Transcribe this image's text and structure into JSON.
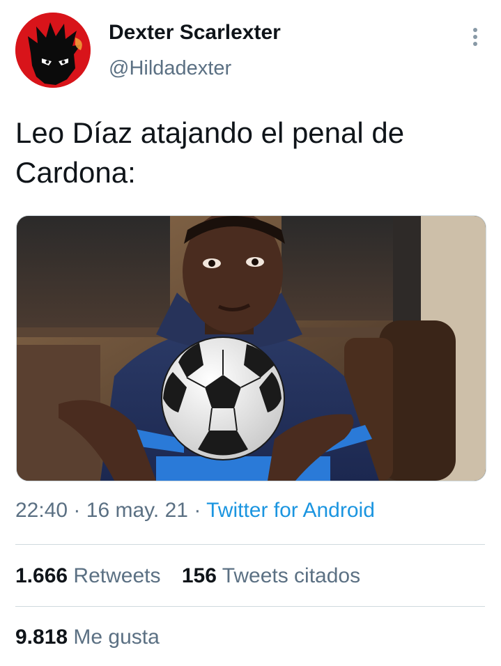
{
  "tweet": {
    "display_name": "Dexter Scarlexter",
    "handle": "@Hildadexter",
    "text_line1": "Leo Díaz atajando el penal de",
    "text_line2": "Cardona:",
    "time": "22:40",
    "separator1": "·",
    "date": "16 may. 21",
    "separator2": "·",
    "source": "Twitter for Android",
    "avatar_icon": "devil-avatar-icon",
    "more_icon": "more-vertical-icon",
    "media_description_icon": "soccer-ball-icon"
  },
  "stats": {
    "retweets_count": "1.666",
    "retweets_label": "Retweets",
    "quotes_count": "156",
    "quotes_label": "Tweets citados",
    "likes_count": "9.818",
    "likes_label": "Me gusta"
  },
  "colors": {
    "accent": "#1b95e0",
    "secondary_text": "#5b7083",
    "primary_text": "#0f1419",
    "divider": "#cfd9de",
    "avatar_bg": "#d8141a"
  }
}
